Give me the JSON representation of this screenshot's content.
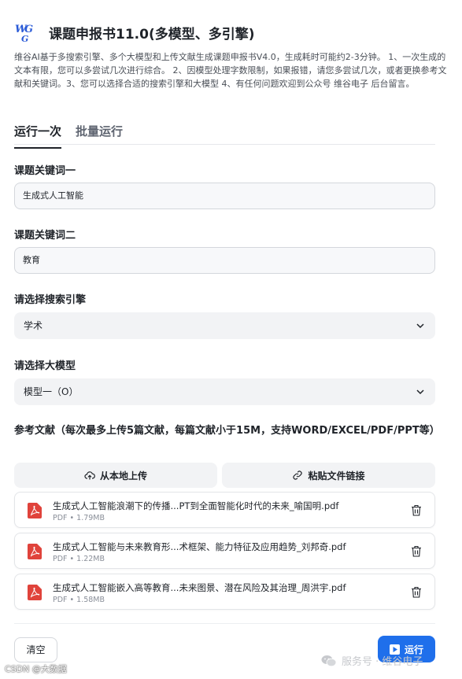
{
  "app": {
    "title": "课题申报书11.0(多模型、多引擎)",
    "description": "维谷AI基于多搜索引擎、多个大模型和上传文献生成课题申报书V4.0，生成耗时可能约2-3分钟。 1、一次生成的文本有限，您可以多尝试几次进行综合。 2、因模型处理字数限制，如果报错，请您多尝试几次，或者更换参考文献和关键词。3、您可以选择合适的搜索引擎和大模型 4、有任何问题欢迎到公众号 维谷电子 后台留言。"
  },
  "tabs": [
    {
      "label": "运行一次",
      "active": true
    },
    {
      "label": "批量运行",
      "active": false
    }
  ],
  "form": {
    "keyword1_label": "课题关键词一",
    "keyword1_value": "生成式人工智能",
    "keyword2_label": "课题关键词二",
    "keyword2_value": "教育",
    "engine_label": "请选择搜索引擎",
    "engine_value": "学术",
    "model_label": "请选择大模型",
    "model_value": "模型一（O）",
    "refs_label": "参考文献（每次最多上传5篇文献，每篇文献小于15M，支持WORD/EXCEL/PDF/PPT等）",
    "upload_local_label": "从本地上传",
    "paste_link_label": "粘贴文件链接"
  },
  "files": [
    {
      "name": "生成式人工智能浪潮下的传播...PT到全面智能化时代的未来_喻国明.pdf",
      "meta": "PDF • 1.79MB"
    },
    {
      "name": "生成式人工智能与未来教育形...术框架、能力特征及应用趋势_刘邦奇.pdf",
      "meta": "PDF • 1.22MB"
    },
    {
      "name": "生成式人工智能嵌入高等教育...未来图景、潜在风险及其治理_周洪宇.pdf",
      "meta": "PDF • 1.58MB"
    }
  ],
  "actions": {
    "clear_label": "清空",
    "run_label": "运行"
  },
  "watermark": {
    "left": "CSDN @大数据",
    "right": "服务号 · 维谷电子"
  },
  "colors": {
    "accent": "#1f6feb",
    "pdf_red": "#e0433b"
  }
}
